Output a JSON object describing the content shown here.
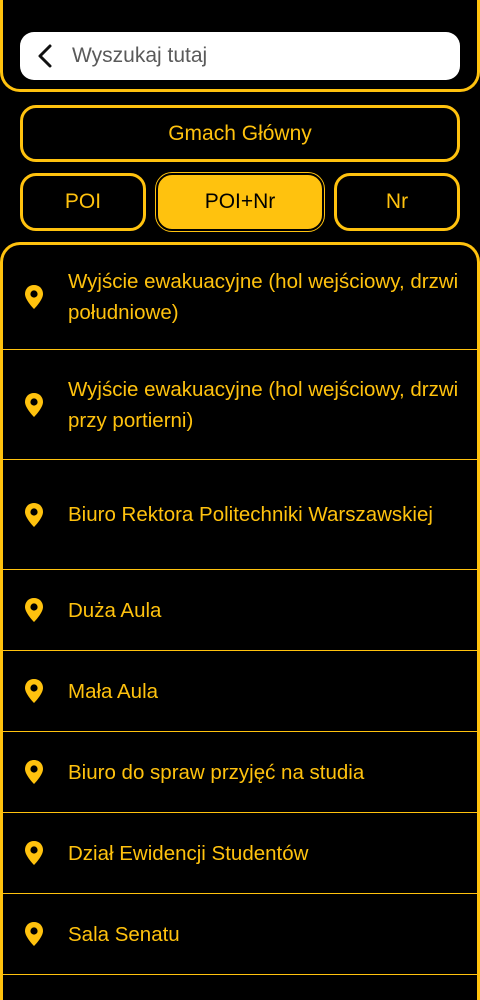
{
  "search": {
    "placeholder": "Wyszukaj tutaj",
    "value": ""
  },
  "building": {
    "label": "Gmach Główny"
  },
  "modes": {
    "poi": "POI",
    "poi_nr": "POI+Nr",
    "nr": "Nr",
    "selected": "POI+Nr"
  },
  "colors": {
    "accent": "#FFC20E",
    "background": "#000000",
    "search_bg": "#FFFFFF"
  },
  "items": [
    {
      "label": "Wyjście ewakuacyjne (hol wejściowy, drzwi południowe)",
      "icon": "map-pin-icon"
    },
    {
      "label": "Wyjście ewakuacyjne (hol wejściowy, drzwi przy portierni)",
      "icon": "map-pin-icon"
    },
    {
      "label": "Biuro Rektora Politechniki Warszawskiej",
      "icon": "map-pin-icon"
    },
    {
      "label": "Duża Aula",
      "icon": "map-pin-icon"
    },
    {
      "label": "Mała Aula",
      "icon": "map-pin-icon"
    },
    {
      "label": "Biuro do spraw przyjęć na studia",
      "icon": "map-pin-icon"
    },
    {
      "label": "Dział Ewidencji Studentów",
      "icon": "map-pin-icon"
    },
    {
      "label": "Sala Senatu",
      "icon": "map-pin-icon"
    }
  ]
}
